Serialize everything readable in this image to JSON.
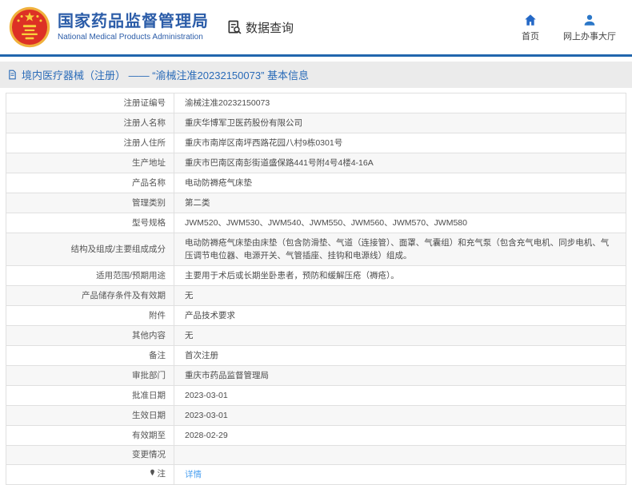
{
  "header": {
    "org_cn": "国家药品监督管理局",
    "org_en": "National Medical Products Administration",
    "section_label": "数据查询",
    "nav": [
      {
        "label": "首页",
        "icon": "home-icon"
      },
      {
        "label": "网上办事大厅",
        "icon": "user-icon"
      }
    ]
  },
  "breadcrumb": {
    "text": "境内医疗器械（注册） —— “渝械注准20232150073” 基本信息"
  },
  "colors": {
    "accent_blue": "#2b5ca8",
    "header_line_blue": "#2166ad",
    "breadcrumb_blue": "#2a6bb8",
    "link_blue": "#4da1f0",
    "emblem_red": "#dd3125",
    "emblem_gold": "#f8c53c",
    "stripe_gray": "#f7f7f7"
  },
  "table": {
    "rows": [
      {
        "label": "注册证编号",
        "value": "渝械注准20232150073"
      },
      {
        "label": "注册人名称",
        "value": "重庆华博军卫医药股份有限公司"
      },
      {
        "label": "注册人住所",
        "value": "重庆市南岸区南坪西路花园八村9栋0301号"
      },
      {
        "label": "生产地址",
        "value": "重庆市巴南区南彭街道盛保路441号附4号4楼4-16A"
      },
      {
        "label": "产品名称",
        "value": "电动防褥疮气床垫"
      },
      {
        "label": "管理类别",
        "value": "第二类"
      },
      {
        "label": "型号规格",
        "value": "JWM520、JWM530、JWM540、JWM550、JWM560、JWM570、JWM580"
      },
      {
        "label": "结构及组成/主要组成成分",
        "value": "电动防褥疮气床垫由床垫（包含防滑垫、气道（连接管）、面罩、气囊组）和充气泵（包含充气电机、同步电机、气压调节电位器、电源开关、气管插座、挂钩和电源线）组成。"
      },
      {
        "label": "适用范围/预期用途",
        "value": "主要用于术后或长期坐卧患者，预防和缓解压疮（褥疮）。"
      },
      {
        "label": "产品储存条件及有效期",
        "value": "无"
      },
      {
        "label": "附件",
        "value": "产品技术要求"
      },
      {
        "label": "其他内容",
        "value": "无"
      },
      {
        "label": "备注",
        "value": "首次注册"
      },
      {
        "label": "审批部门",
        "value": "重庆市药品监督管理局"
      },
      {
        "label": "批准日期",
        "value": "2023-03-01"
      },
      {
        "label": "生效日期",
        "value": "2023-03-01"
      },
      {
        "label": "有效期至",
        "value": "2028-02-29"
      },
      {
        "label": "变更情况",
        "value": ""
      },
      {
        "label": "注",
        "label_icon": "pin-icon",
        "value": "详情",
        "value_is_link": true
      }
    ]
  }
}
